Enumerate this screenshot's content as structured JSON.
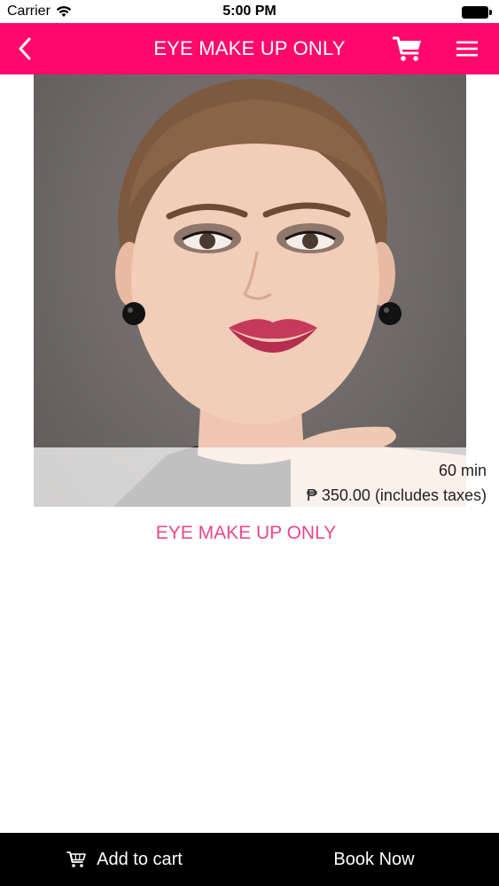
{
  "status_bar": {
    "carrier": "Carrier",
    "time": "5:00 PM"
  },
  "nav": {
    "title": "EYE MAKE UP ONLY",
    "back_icon": "chevron-left-icon",
    "cart_icon": "shopping-cart-icon",
    "menu_icon": "hamburger-menu-icon"
  },
  "product": {
    "duration": "60 min",
    "price": "₱ 350.00 (includes taxes)",
    "name": "EYE MAKE UP ONLY"
  },
  "actions": {
    "add_to_cart": "Add to cart",
    "book_now": "Book Now"
  },
  "colors": {
    "brand": "#ff0a6c",
    "product_name": "#e9478e",
    "bottom_bar": "#000000"
  }
}
